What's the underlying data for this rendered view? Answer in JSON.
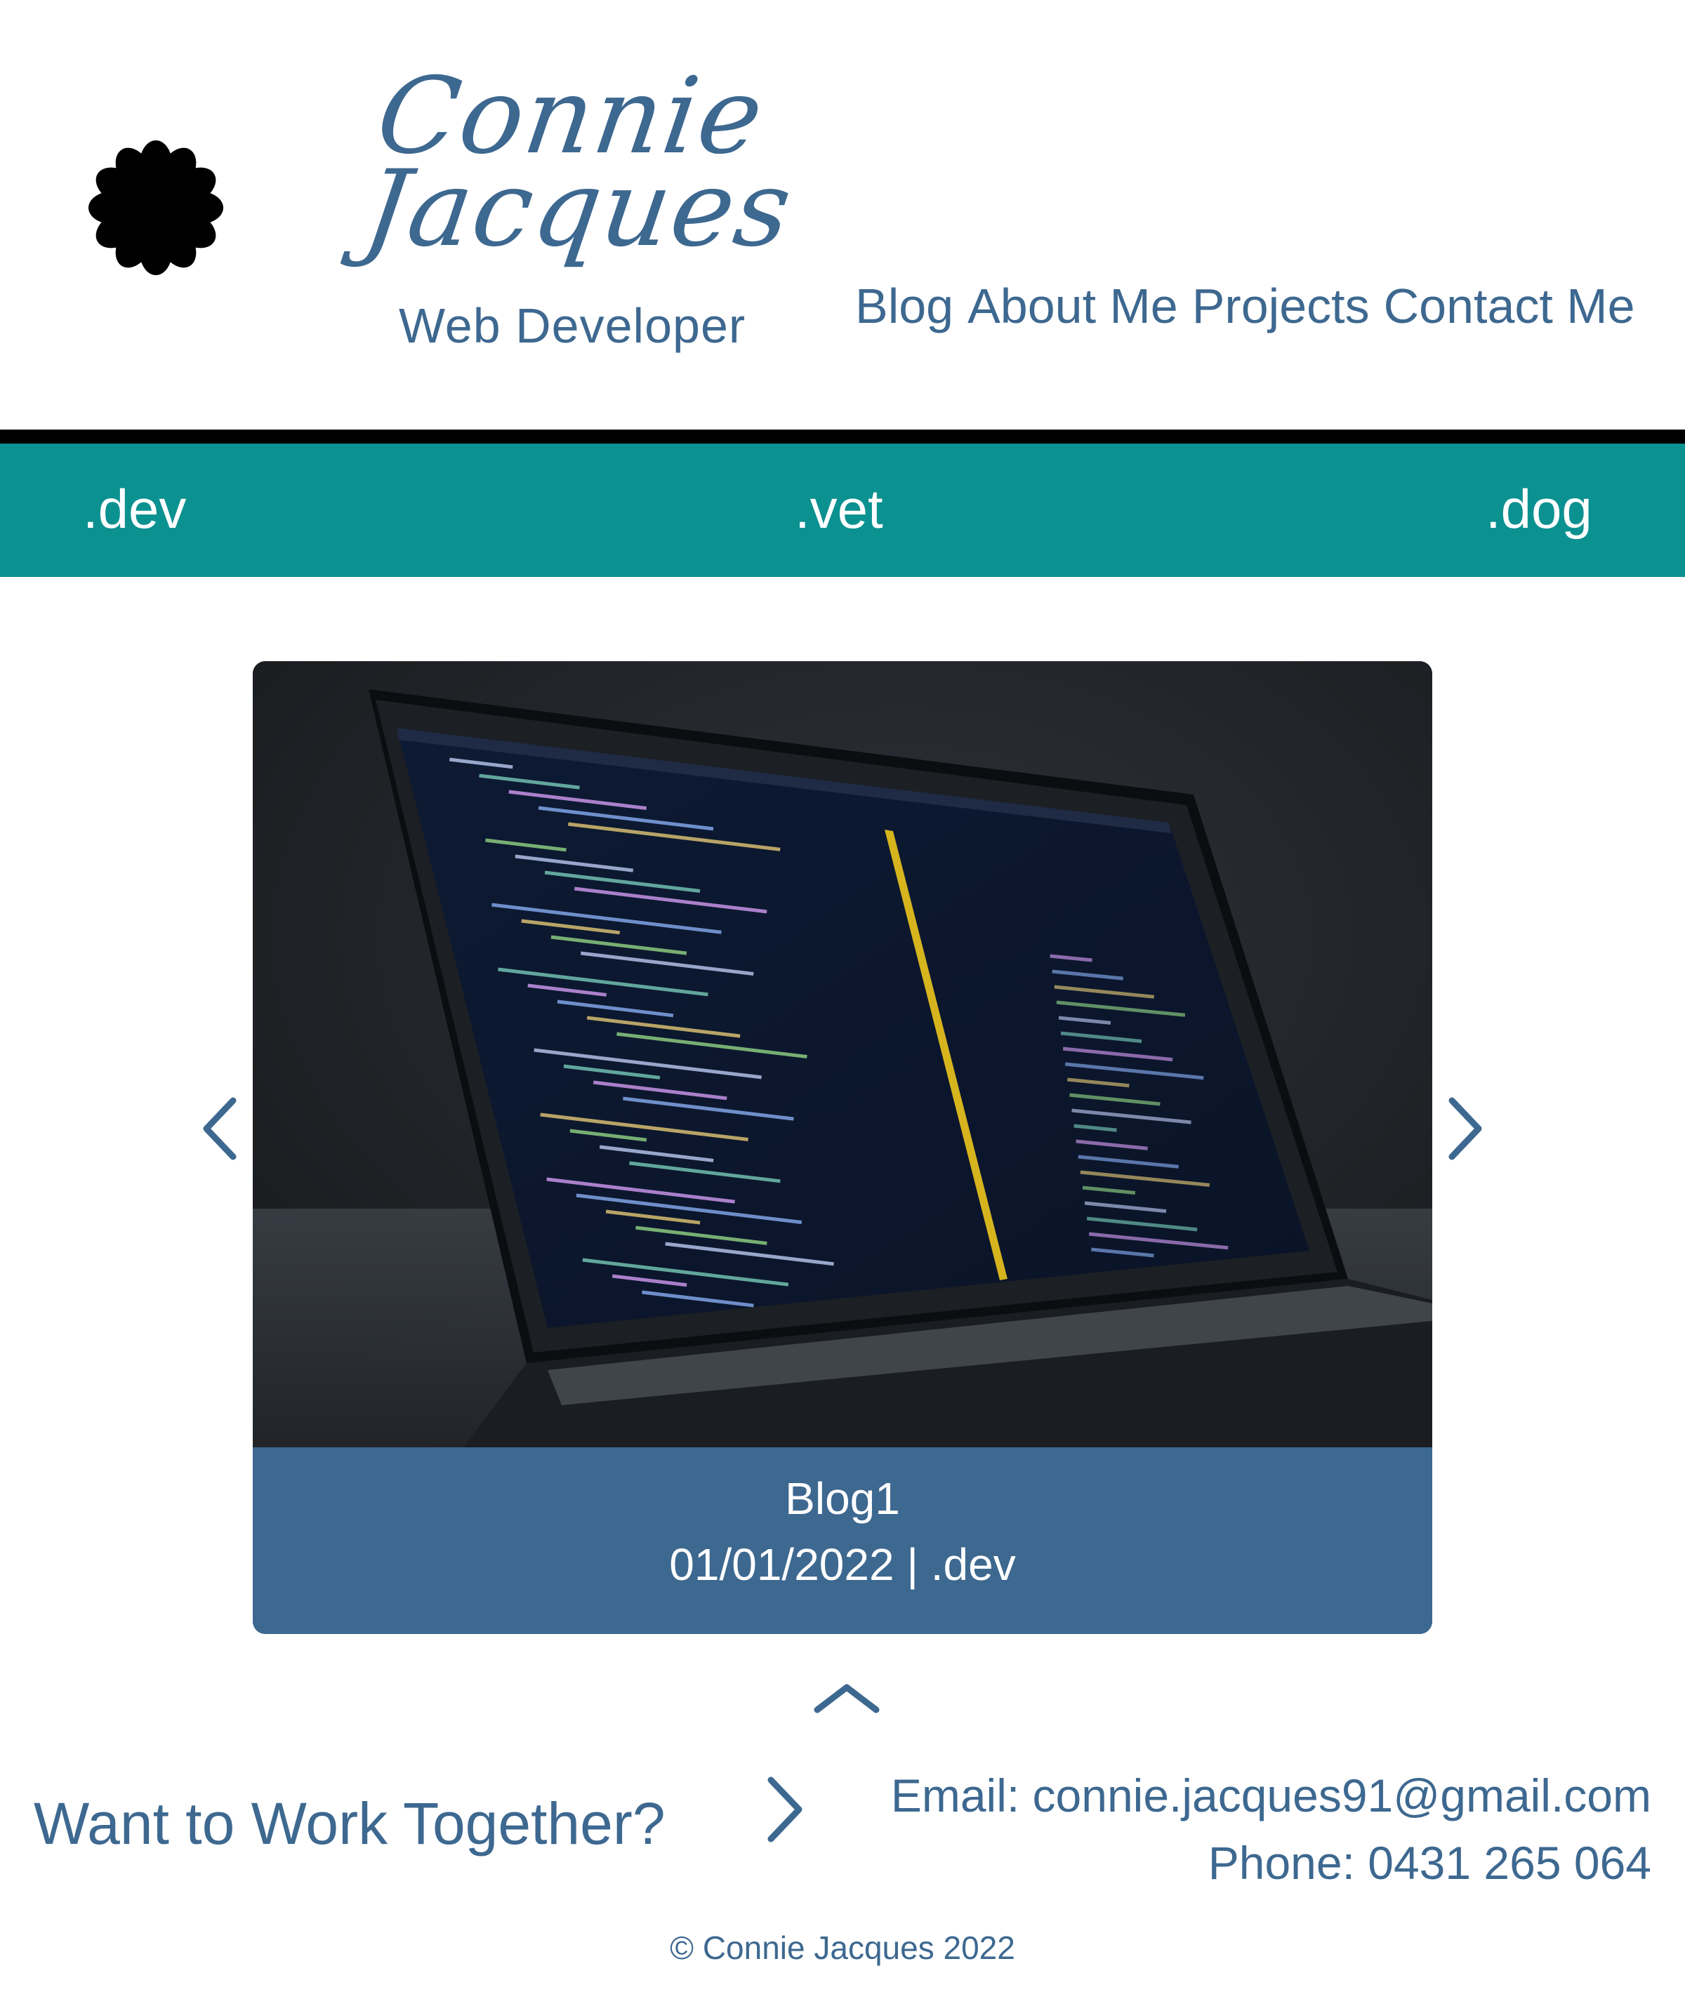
{
  "header": {
    "brand_first": "Connie",
    "brand_last": "Jacques",
    "subtitle": "Web Developer",
    "nav": [
      "Blog",
      "About Me",
      "Projects",
      "Contact Me"
    ]
  },
  "categories": [
    ".dev",
    ".vet",
    ".dog"
  ],
  "carousel": {
    "title": "Blog1",
    "meta": "01/01/2022 | .dev"
  },
  "footer": {
    "cta": "Want to Work Together?",
    "email": "Email: connie.jacques91@gmail.com",
    "phone": "Phone: 0431 265 064",
    "copyright": "© Connie Jacques 2022"
  },
  "colors": {
    "accent": "#3d6890",
    "category_bar": "#0c9191",
    "rule": "#000000"
  },
  "icons": [
    "flower-logo-icon",
    "chevron-left-icon",
    "chevron-right-icon",
    "chevron-up-icon"
  ]
}
